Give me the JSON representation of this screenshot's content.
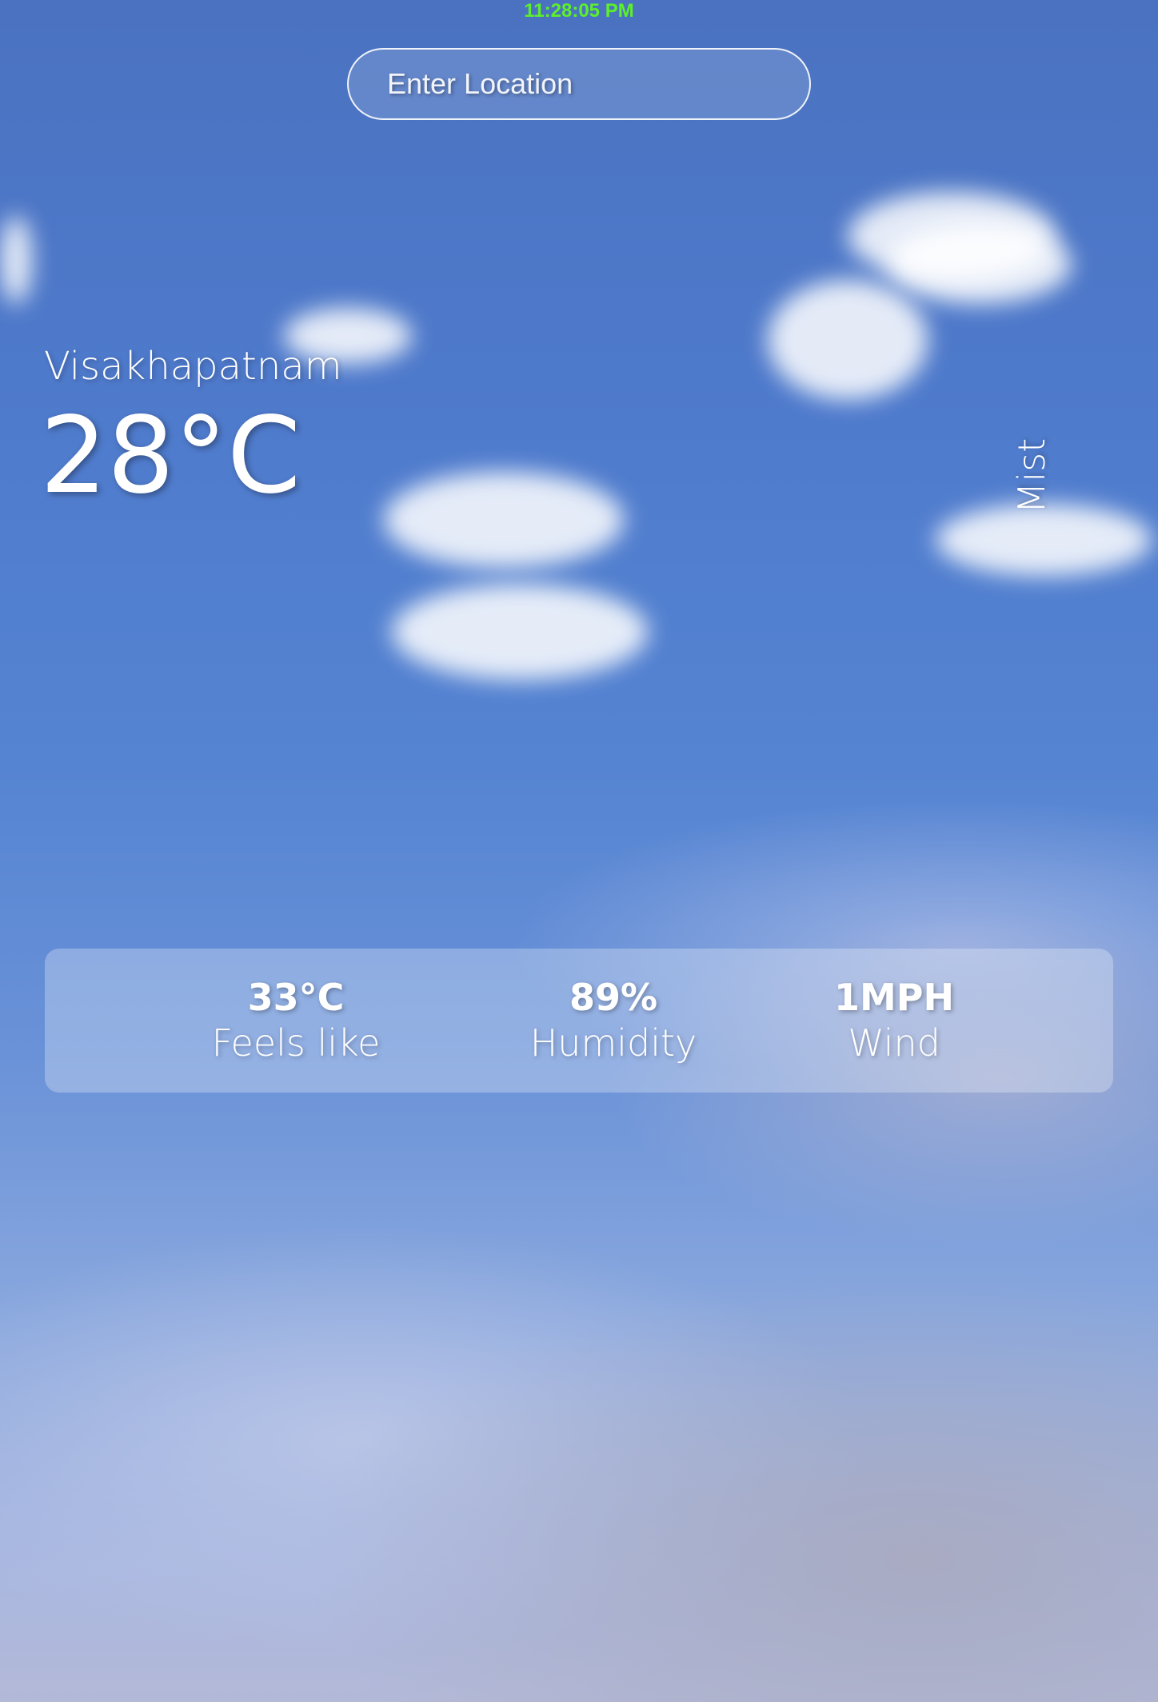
{
  "clock": {
    "time": "11:28:05 PM"
  },
  "search": {
    "placeholder": "Enter Location"
  },
  "location": {
    "city": "Visakhapatnam"
  },
  "current": {
    "temperature": "28°C",
    "condition": "Mist"
  },
  "details": [
    {
      "value": "33°C",
      "label": "Feels like"
    },
    {
      "value": "89%",
      "label": "Humidity"
    },
    {
      "value": "1MPH",
      "label": "Wind"
    }
  ],
  "colors": {
    "clock": "#5cf02a",
    "text": "#ffffff",
    "sky": "#4f7bcd"
  }
}
